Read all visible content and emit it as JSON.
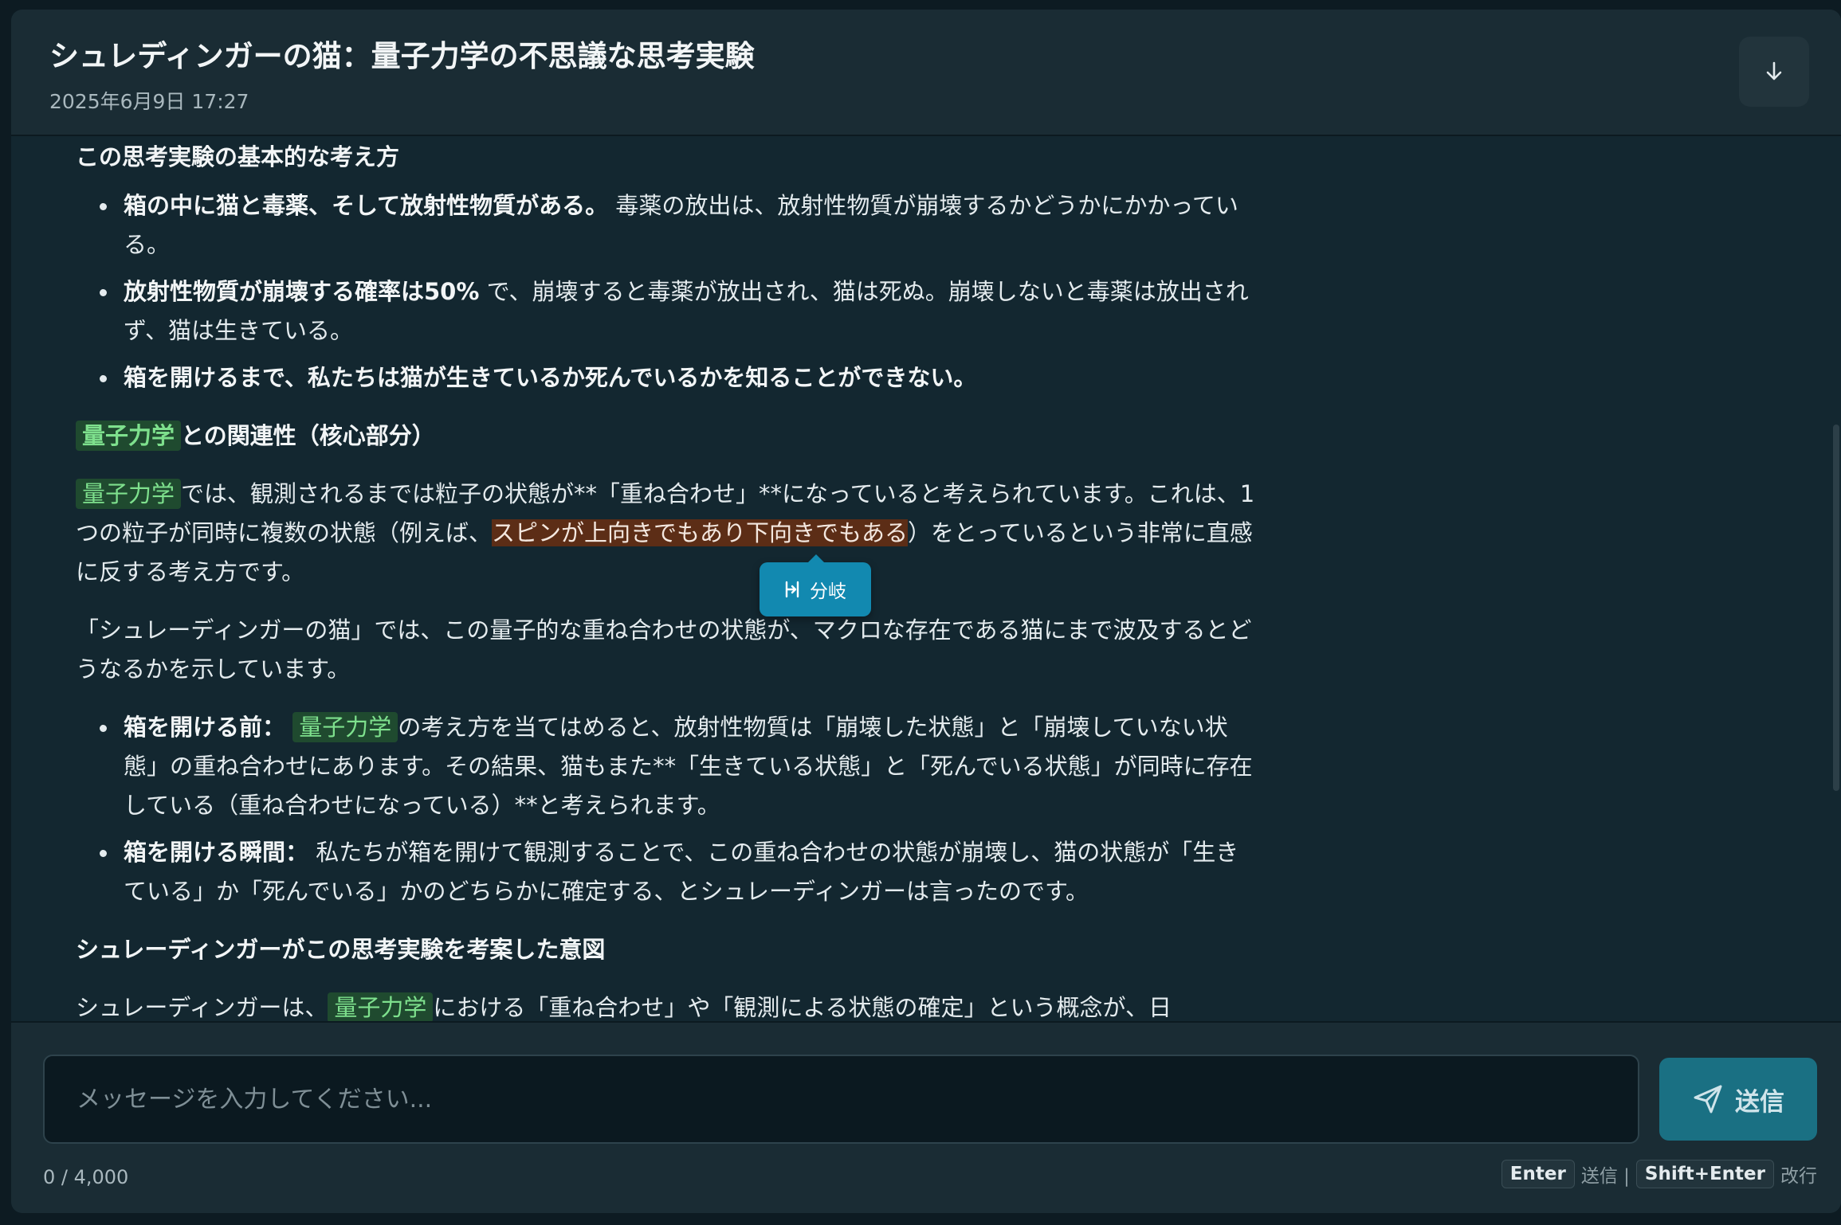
{
  "header": {
    "title": "シュレディンガーの猫：量子力学の不思議な思考実験",
    "date": "2025年6月9日 17:27",
    "download_icon": "arrow-down-icon"
  },
  "content": {
    "section1_heading": "この思考実験の基本的な考え方",
    "bullets1": [
      {
        "bold": "箱の中に猫と毒薬、そして放射性物質がある。",
        "text": " 毒薬の放出は、放射性物質が崩壊するかどうかにかかっている。"
      },
      {
        "bold": "放射性物質が崩壊する確率は50%",
        "text": " で、崩壊すると毒薬が放出され、猫は死ぬ。崩壊しないと毒薬は放出されず、猫は生きている。"
      },
      {
        "bold": "箱を開けるまで、私たちは猫が生きているか死んでいるかを知ることができない。",
        "text": ""
      }
    ],
    "section2_heading_hl": "量子力学",
    "section2_heading_rest": "との関連性（核心部分）",
    "para1_hl": "量子力学",
    "para1_a": "では、観測されるまでは粒子の状態が**「重ね合わせ」**になっていると考えられています。これは、1つの粒子が同時に複数の状態（例えば、",
    "para1_sel": "スピンが上向きでもあり下向きでもある",
    "para1_b": "）をとっているという非常に直感に反する考え方です。",
    "para2": "「シュレーディンガーの猫」では、この量子的な重ね合わせの状態が、マクロな存在である猫にまで波及するとどうなるかを示しています。",
    "bullet2_1_bold": "箱を開ける前：",
    "bullet2_1_hl": "量子力学",
    "bullet2_1_text": "の考え方を当てはめると、放射性物質は「崩壊した状態」と「崩壊していない状態」の重ね合わせにあります。その結果、猫もまた**「生きている状態」と「死んでいる状態」が同時に存在している（重ね合わせになっている）**と考えられます。",
    "bullet2_2_bold": "箱を開ける瞬間：",
    "bullet2_2_text": " 私たちが箱を開けて観測することで、この重ね合わせの状態が崩壊し、猫の状態が「生きている」か「死んでいる」かのどちらかに確定する、とシュレーディンガーは言ったのです。",
    "section3_heading": "シュレーディンガーがこの思考実験を考案した意図",
    "para3_a": "シュレーディンガーは、",
    "para3_hl": "量子力学",
    "para3_b": "における「重ね合わせ」や「観測による状態の確定」という概念が、日"
  },
  "branch_popup": {
    "label": "分岐",
    "icon": "branch-icon"
  },
  "footer": {
    "placeholder": "メッセージを入力してください...",
    "send_label": "送信",
    "send_icon": "send-icon",
    "counter": "0 / 4,000",
    "hint_key1": "Enter",
    "hint_text1": "送信 |",
    "hint_key2": "Shift+Enter",
    "hint_text2": "改行"
  }
}
